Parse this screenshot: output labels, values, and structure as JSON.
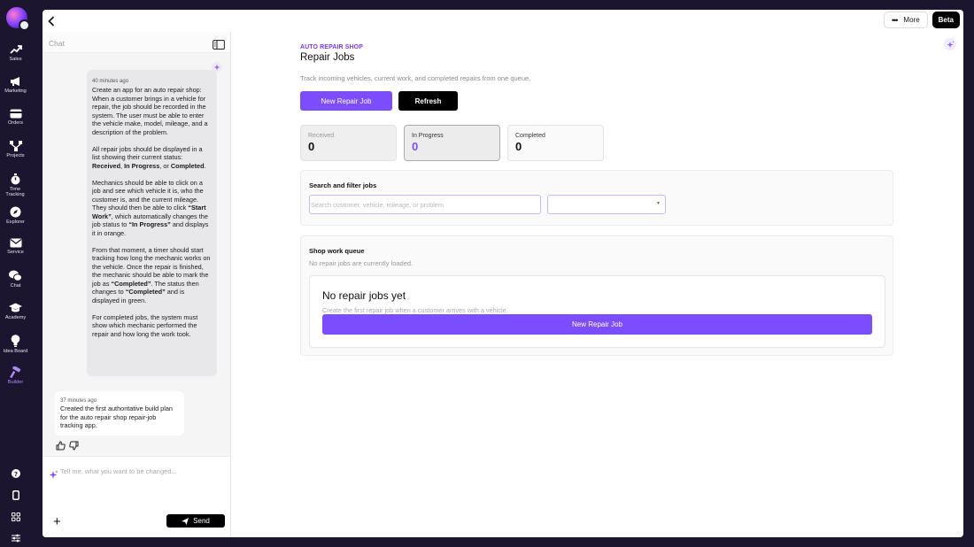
{
  "rail": {
    "items": [
      {
        "label": "Sales",
        "icon": "trending-up-icon"
      },
      {
        "label": "Marketing",
        "icon": "megaphone-icon"
      },
      {
        "label": "Orders",
        "icon": "credit-card-icon"
      },
      {
        "label": "Projects",
        "icon": "network-icon"
      },
      {
        "label": "Time Tracking",
        "icon": "stopwatch-icon"
      },
      {
        "label": "Explorer",
        "icon": "compass-icon"
      },
      {
        "label": "Service",
        "icon": "mail-icon"
      },
      {
        "label": "Chat",
        "icon": "chat-bubbles-icon"
      },
      {
        "label": "Academy",
        "icon": "graduation-cap-icon"
      },
      {
        "label": "Idea Board",
        "icon": "lightbulb-icon"
      },
      {
        "label": "Builder",
        "icon": "hammer-icon",
        "active": true
      }
    ],
    "bottom_icons": [
      "help-icon",
      "mobile-icon",
      "apps-grid-icon",
      "sliders-icon"
    ]
  },
  "topbar": {
    "more_label": "More",
    "beta_label": "Beta"
  },
  "chat": {
    "title": "Chat",
    "user_message": {
      "time": "40 minutes ago",
      "p1": "Create an app for an auto repair shop: When a customer brings in a vehicle for repair, the job should be recorded in the system. The user must be able to enter the vehicle make, model, mileage, and a description of the problem.",
      "p2_pre": "All repair jobs should be displayed in a list showing their current status: ",
      "p2_s1": "Received",
      "p2_c1": ", ",
      "p2_s2": "In Progress",
      "p2_c2": ", or ",
      "p2_s3": "Completed",
      "p2_end": ".",
      "p3_pre": "Mechanics should be able to click on a job and see which vehicle it is, who the customer is, and the current mileage. They should then be able to click ",
      "p3_b1": "“Start Work”",
      "p3_mid": ", which automatically changes the job status to ",
      "p3_b2": "“In Progress”",
      "p3_end": " and displays it in orange.",
      "p4_pre": "From that moment, a timer should start tracking how long the mechanic works on the vehicle. Once the repair is finished, the mechanic should be able to mark the job as ",
      "p4_b1": "“Completed”",
      "p4_mid": ". The status then changes to ",
      "p4_b2": "“Completed”",
      "p4_end": " and is displayed in green.",
      "p5": "For completed jobs, the system must show which mechanic performed the repair and how long the work took."
    },
    "ai_message": {
      "time": "37 minutes ago",
      "text": "Created the first authoritative build plan for the auto repair shop repair-job tracking app."
    },
    "composer": {
      "placeholder": "Tell me, what you want to be changed...",
      "send_label": "Send"
    }
  },
  "app": {
    "eyebrow": "AUTO REPAIR SHOP",
    "title": "Repair Jobs",
    "subtitle": "Track incoming vehicles, current work, and completed repairs from one queue.",
    "new_job_label": "New Repair Job",
    "refresh_label": "Refresh",
    "stats": [
      {
        "label": "Received",
        "value": "0"
      },
      {
        "label": "In Progress",
        "value": "0"
      },
      {
        "label": "Completed",
        "value": "0"
      }
    ],
    "search_card": {
      "heading": "Search and filter jobs",
      "placeholder": "Search customer, vehicle, mileage, or problem",
      "select_value": ""
    },
    "queue_card": {
      "heading": "Shop work queue",
      "subtitle": "No repair jobs are currently loaded.",
      "empty_title": "No repair jobs yet",
      "empty_text": "Create the first repair job when a customer arrives with a vehicle.",
      "empty_button": "New Repair Job"
    }
  },
  "colors": {
    "accent": "#7c4dff",
    "eyebrow": "#7c3aed",
    "rail_bg": "#1c1530"
  }
}
